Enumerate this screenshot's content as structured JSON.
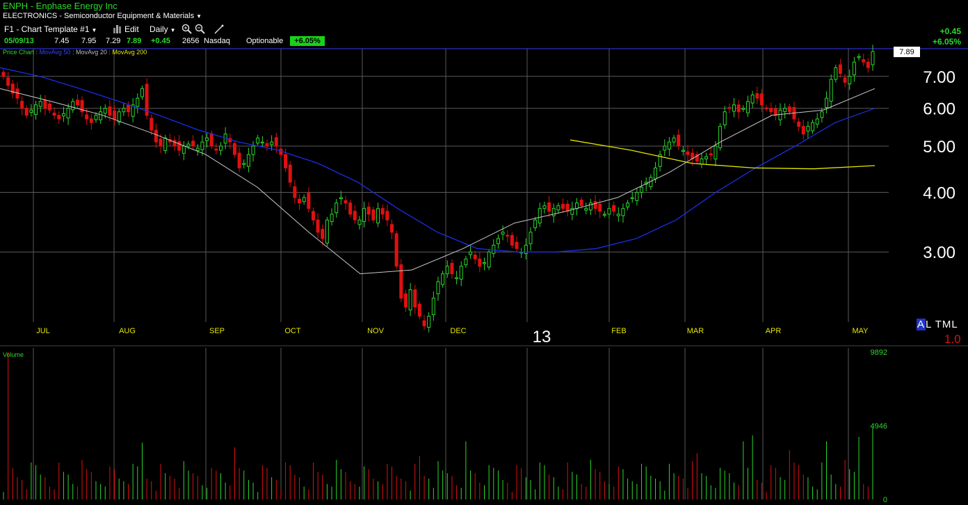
{
  "header": {
    "symbol_line": "ENPH - Enphase Energy Inc",
    "industry": "ELECTRONICS - Semiconductor Equipment & Materials"
  },
  "toolbar": {
    "template": "F1 - Chart Template #1",
    "edit": "Edit",
    "period": "Daily"
  },
  "quote": {
    "date": "05/09/13",
    "open": "7.45",
    "high": "7.95",
    "low": "7.29",
    "close": "7.89",
    "change": "+0.45",
    "volume": "2656",
    "exchange": "Nasdaq",
    "optionable": "Optionable",
    "pct_change": "+6.05%"
  },
  "right_panel": {
    "change": "+0.45",
    "pct_change": "+6.05%",
    "last_price_tag": "7.89"
  },
  "legend": {
    "price_chart": "Price Chart",
    "ma50": "MovAvg 50",
    "ma20": "MovAvg 20",
    "ma200": "MovAvg 200",
    "separator": ":"
  },
  "footer": {
    "alt_prefix": "A",
    "alt_rest": "L TML",
    "version": "1.0",
    "year_marker": "13"
  },
  "colors": {
    "up": "#2bd92b",
    "down": "#e01010",
    "ma50": "#1a2ee6",
    "ma20": "#c8c8c8",
    "ma200": "#e6e600",
    "grid": "#5a5a5a",
    "axis_month": "#e6e600"
  },
  "chart_data": [
    {
      "type": "candlestick",
      "title": "ENPH - Enphase Energy Inc",
      "period": "Daily",
      "x_tick_labels": [
        "JUL",
        "AUG",
        "SEP",
        "OCT",
        "NOV",
        "DEC",
        "13",
        "FEB",
        "MAR",
        "APR",
        "MAY"
      ],
      "y_tick_labels": [
        "3.00",
        "4.00",
        "5.00",
        "6.00",
        "7.00"
      ],
      "y_scale": "log",
      "ylim": [
        2.0,
        8.0
      ],
      "grid": true,
      "closes_approx": [
        7.0,
        6.7,
        6.45,
        6.3,
        6.0,
        5.8,
        5.95,
        6.1,
        6.2,
        6.0,
        5.95,
        5.8,
        5.7,
        5.85,
        6.0,
        6.2,
        6.1,
        5.9,
        5.7,
        5.6,
        5.8,
        5.9,
        6.0,
        5.8,
        5.7,
        5.9,
        6.0,
        5.9,
        6.1,
        6.3,
        6.6,
        5.8,
        5.4,
        5.1,
        5.0,
        5.2,
        5.1,
        5.0,
        4.9,
        5.0,
        5.05,
        5.0,
        4.95,
        5.1,
        5.2,
        5.0,
        4.9,
        5.0,
        5.3,
        5.1,
        4.8,
        4.5,
        4.6,
        4.8,
        5.0,
        5.2,
        5.1,
        5.0,
        5.1,
        5.0,
        4.8,
        4.5,
        4.2,
        3.9,
        3.8,
        3.9,
        3.7,
        3.5,
        3.3,
        3.2,
        3.5,
        3.6,
        3.8,
        3.9,
        3.8,
        3.6,
        3.5,
        3.5,
        3.7,
        3.6,
        3.5,
        3.7,
        3.6,
        3.5,
        3.3,
        2.8,
        2.4,
        2.3,
        2.5,
        2.3,
        2.2,
        2.1,
        2.2,
        2.4,
        2.6,
        2.7,
        2.8,
        2.7,
        2.65,
        2.8,
        2.9,
        3.0,
        2.9,
        2.8,
        2.85,
        3.0,
        3.1,
        3.2,
        3.3,
        3.25,
        3.1,
        3.05,
        3.0,
        3.1,
        3.3,
        3.5,
        3.7,
        3.75,
        3.65,
        3.7,
        3.75,
        3.7,
        3.65,
        3.7,
        3.8,
        3.75,
        3.7,
        3.8,
        3.7,
        3.65,
        3.6,
        3.7,
        3.65,
        3.6,
        3.7,
        3.8,
        3.9,
        4.0,
        4.1,
        4.2,
        4.3,
        4.5,
        4.8,
        5.0,
        5.1,
        5.2,
        5.0,
        4.9,
        4.8,
        4.7,
        4.65,
        4.7,
        4.75,
        4.8,
        5.0,
        5.5,
        5.9,
        6.0,
        6.1,
        5.9,
        6.0,
        6.2,
        6.4,
        6.3,
        6.1,
        6.0,
        5.9,
        5.8,
        5.95,
        6.0,
        5.9,
        5.7,
        5.5,
        5.3,
        5.5,
        5.6,
        5.7,
        5.9,
        6.3,
        6.9,
        7.3,
        7.1,
        6.8,
        7.0,
        7.5,
        7.7,
        7.5,
        7.3,
        7.89
      ],
      "last_close": 7.89,
      "ma50_approx": [
        7.3,
        7.0,
        6.6,
        6.2,
        5.8,
        5.4,
        5.1,
        4.9,
        4.6,
        4.2,
        3.7,
        3.3,
        3.05,
        3.0,
        3.0,
        3.05,
        3.2,
        3.5,
        4.0,
        4.5,
        5.0,
        5.6,
        6.0
      ],
      "ma20_approx": [
        6.6,
        6.2,
        5.8,
        5.3,
        4.8,
        4.1,
        3.3,
        2.7,
        2.75,
        3.05,
        3.45,
        3.65,
        3.9,
        4.4,
        5.1,
        5.8,
        5.95,
        6.6
      ],
      "ma200_approx": [
        5.15,
        4.9,
        4.6,
        4.5,
        4.48,
        4.55
      ]
    },
    {
      "type": "bar",
      "title": "Volume",
      "y_tick_labels": [
        "9892",
        "4946",
        "0"
      ],
      "ylim": [
        0,
        9892
      ],
      "notable_volumes_approx": [
        9892,
        3800,
        3500,
        2900,
        3900,
        3100,
        3900,
        3300,
        4200,
        4800,
        4300,
        3900
      ]
    }
  ]
}
